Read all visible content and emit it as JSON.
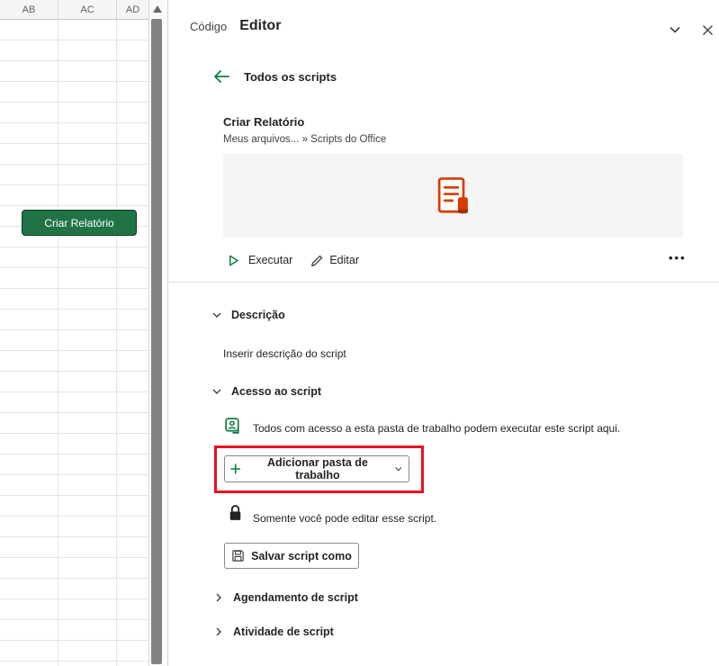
{
  "colors": {
    "excel-green": "#107C41",
    "button-green": "#217346",
    "script-orange": "#D83B01",
    "annotation-red": "#E81123"
  },
  "spreadsheet": {
    "columns": [
      "AB",
      "AC",
      "AD"
    ],
    "shape_button": "Criar Relatório"
  },
  "panel": {
    "app_label": "Código",
    "title": "Editor",
    "back_label": "Todos os scripts",
    "card": {
      "title": "Criar Relatório",
      "path": "Meus arquivos... » Scripts do Office",
      "run": "Executar",
      "edit": "Editar",
      "more": "•••"
    },
    "description": {
      "label": "Descrição",
      "body": "Inserir descrição do script"
    },
    "access": {
      "label": "Acesso ao script",
      "share_text": "Todos com acesso a esta pasta de trabalho podem executar este script aqui.",
      "add_button": "Adicionar pasta de trabalho",
      "lock_text": "Somente você pode editar esse script.",
      "save_button": "Salvar script como"
    },
    "schedule_label": "Agendamento de script",
    "activity_label": "Atividade de script"
  }
}
